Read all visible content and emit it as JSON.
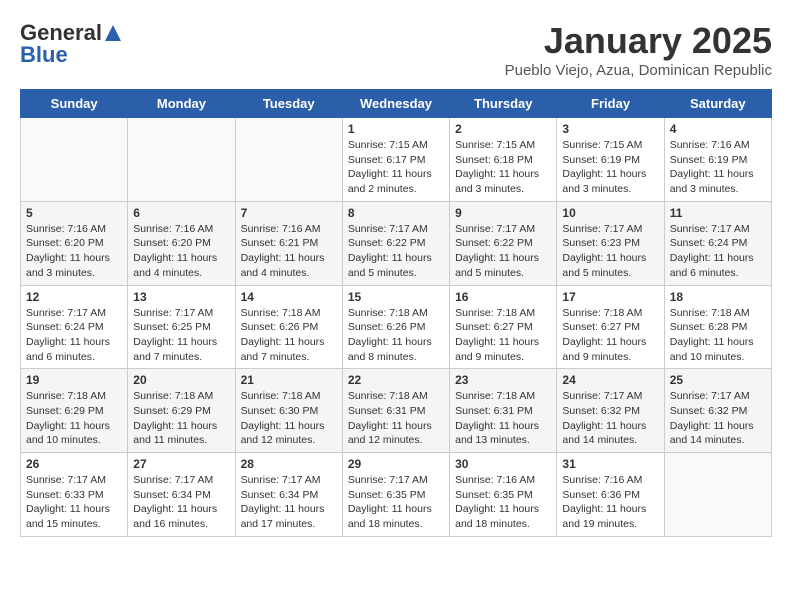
{
  "header": {
    "logo_general": "General",
    "logo_blue": "Blue",
    "month_title": "January 2025",
    "location": "Pueblo Viejo, Azua, Dominican Republic"
  },
  "weekdays": [
    "Sunday",
    "Monday",
    "Tuesday",
    "Wednesday",
    "Thursday",
    "Friday",
    "Saturday"
  ],
  "weeks": [
    [
      {
        "day": "",
        "empty": true
      },
      {
        "day": "",
        "empty": true
      },
      {
        "day": "",
        "empty": true
      },
      {
        "day": "1",
        "sunrise": "Sunrise: 7:15 AM",
        "sunset": "Sunset: 6:17 PM",
        "daylight": "Daylight: 11 hours and 2 minutes."
      },
      {
        "day": "2",
        "sunrise": "Sunrise: 7:15 AM",
        "sunset": "Sunset: 6:18 PM",
        "daylight": "Daylight: 11 hours and 3 minutes."
      },
      {
        "day": "3",
        "sunrise": "Sunrise: 7:15 AM",
        "sunset": "Sunset: 6:19 PM",
        "daylight": "Daylight: 11 hours and 3 minutes."
      },
      {
        "day": "4",
        "sunrise": "Sunrise: 7:16 AM",
        "sunset": "Sunset: 6:19 PM",
        "daylight": "Daylight: 11 hours and 3 minutes."
      }
    ],
    [
      {
        "day": "5",
        "sunrise": "Sunrise: 7:16 AM",
        "sunset": "Sunset: 6:20 PM",
        "daylight": "Daylight: 11 hours and 3 minutes."
      },
      {
        "day": "6",
        "sunrise": "Sunrise: 7:16 AM",
        "sunset": "Sunset: 6:20 PM",
        "daylight": "Daylight: 11 hours and 4 minutes."
      },
      {
        "day": "7",
        "sunrise": "Sunrise: 7:16 AM",
        "sunset": "Sunset: 6:21 PM",
        "daylight": "Daylight: 11 hours and 4 minutes."
      },
      {
        "day": "8",
        "sunrise": "Sunrise: 7:17 AM",
        "sunset": "Sunset: 6:22 PM",
        "daylight": "Daylight: 11 hours and 5 minutes."
      },
      {
        "day": "9",
        "sunrise": "Sunrise: 7:17 AM",
        "sunset": "Sunset: 6:22 PM",
        "daylight": "Daylight: 11 hours and 5 minutes."
      },
      {
        "day": "10",
        "sunrise": "Sunrise: 7:17 AM",
        "sunset": "Sunset: 6:23 PM",
        "daylight": "Daylight: 11 hours and 5 minutes."
      },
      {
        "day": "11",
        "sunrise": "Sunrise: 7:17 AM",
        "sunset": "Sunset: 6:24 PM",
        "daylight": "Daylight: 11 hours and 6 minutes."
      }
    ],
    [
      {
        "day": "12",
        "sunrise": "Sunrise: 7:17 AM",
        "sunset": "Sunset: 6:24 PM",
        "daylight": "Daylight: 11 hours and 6 minutes."
      },
      {
        "day": "13",
        "sunrise": "Sunrise: 7:17 AM",
        "sunset": "Sunset: 6:25 PM",
        "daylight": "Daylight: 11 hours and 7 minutes."
      },
      {
        "day": "14",
        "sunrise": "Sunrise: 7:18 AM",
        "sunset": "Sunset: 6:26 PM",
        "daylight": "Daylight: 11 hours and 7 minutes."
      },
      {
        "day": "15",
        "sunrise": "Sunrise: 7:18 AM",
        "sunset": "Sunset: 6:26 PM",
        "daylight": "Daylight: 11 hours and 8 minutes."
      },
      {
        "day": "16",
        "sunrise": "Sunrise: 7:18 AM",
        "sunset": "Sunset: 6:27 PM",
        "daylight": "Daylight: 11 hours and 9 minutes."
      },
      {
        "day": "17",
        "sunrise": "Sunrise: 7:18 AM",
        "sunset": "Sunset: 6:27 PM",
        "daylight": "Daylight: 11 hours and 9 minutes."
      },
      {
        "day": "18",
        "sunrise": "Sunrise: 7:18 AM",
        "sunset": "Sunset: 6:28 PM",
        "daylight": "Daylight: 11 hours and 10 minutes."
      }
    ],
    [
      {
        "day": "19",
        "sunrise": "Sunrise: 7:18 AM",
        "sunset": "Sunset: 6:29 PM",
        "daylight": "Daylight: 11 hours and 10 minutes."
      },
      {
        "day": "20",
        "sunrise": "Sunrise: 7:18 AM",
        "sunset": "Sunset: 6:29 PM",
        "daylight": "Daylight: 11 hours and 11 minutes."
      },
      {
        "day": "21",
        "sunrise": "Sunrise: 7:18 AM",
        "sunset": "Sunset: 6:30 PM",
        "daylight": "Daylight: 11 hours and 12 minutes."
      },
      {
        "day": "22",
        "sunrise": "Sunrise: 7:18 AM",
        "sunset": "Sunset: 6:31 PM",
        "daylight": "Daylight: 11 hours and 12 minutes."
      },
      {
        "day": "23",
        "sunrise": "Sunrise: 7:18 AM",
        "sunset": "Sunset: 6:31 PM",
        "daylight": "Daylight: 11 hours and 13 minutes."
      },
      {
        "day": "24",
        "sunrise": "Sunrise: 7:17 AM",
        "sunset": "Sunset: 6:32 PM",
        "daylight": "Daylight: 11 hours and 14 minutes."
      },
      {
        "day": "25",
        "sunrise": "Sunrise: 7:17 AM",
        "sunset": "Sunset: 6:32 PM",
        "daylight": "Daylight: 11 hours and 14 minutes."
      }
    ],
    [
      {
        "day": "26",
        "sunrise": "Sunrise: 7:17 AM",
        "sunset": "Sunset: 6:33 PM",
        "daylight": "Daylight: 11 hours and 15 minutes."
      },
      {
        "day": "27",
        "sunrise": "Sunrise: 7:17 AM",
        "sunset": "Sunset: 6:34 PM",
        "daylight": "Daylight: 11 hours and 16 minutes."
      },
      {
        "day": "28",
        "sunrise": "Sunrise: 7:17 AM",
        "sunset": "Sunset: 6:34 PM",
        "daylight": "Daylight: 11 hours and 17 minutes."
      },
      {
        "day": "29",
        "sunrise": "Sunrise: 7:17 AM",
        "sunset": "Sunset: 6:35 PM",
        "daylight": "Daylight: 11 hours and 18 minutes."
      },
      {
        "day": "30",
        "sunrise": "Sunrise: 7:16 AM",
        "sunset": "Sunset: 6:35 PM",
        "daylight": "Daylight: 11 hours and 18 minutes."
      },
      {
        "day": "31",
        "sunrise": "Sunrise: 7:16 AM",
        "sunset": "Sunset: 6:36 PM",
        "daylight": "Daylight: 11 hours and 19 minutes."
      },
      {
        "day": "",
        "empty": true
      }
    ]
  ]
}
